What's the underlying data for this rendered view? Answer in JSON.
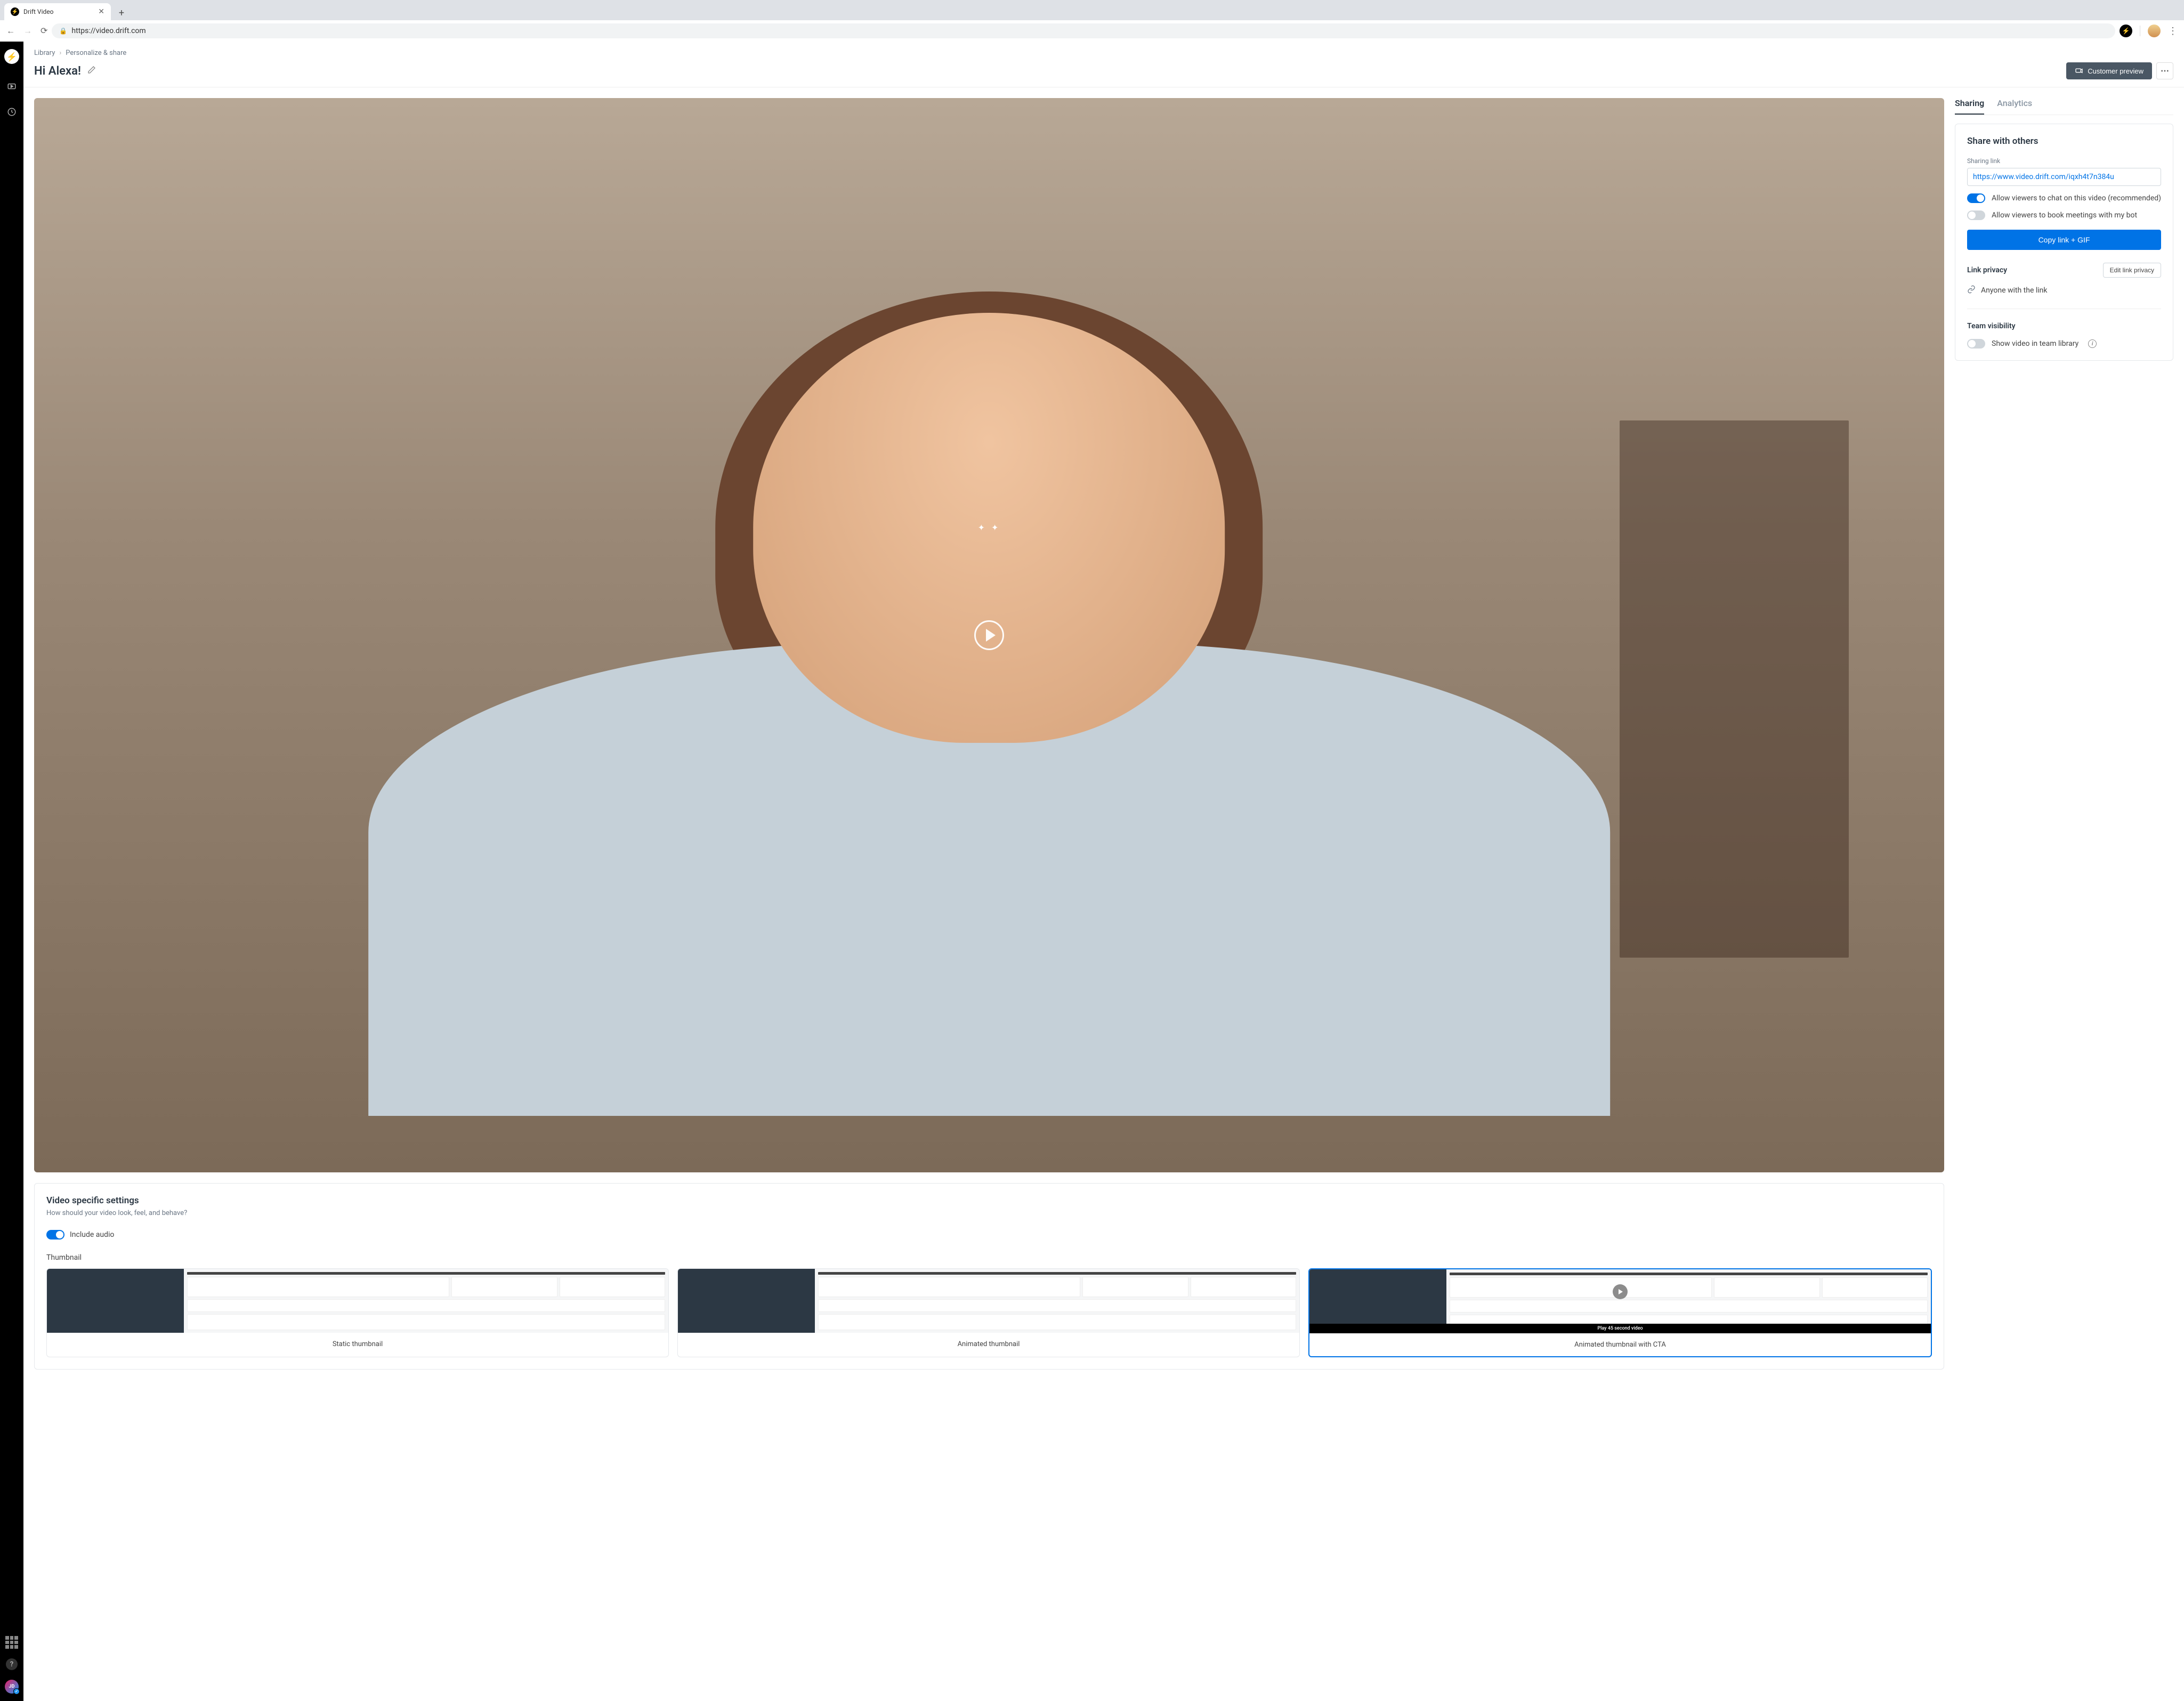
{
  "browser": {
    "tab_title": "Drift Video",
    "url": "https://video.drift.com"
  },
  "sidebar": {
    "user_initials": "JD"
  },
  "breadcrumbs": {
    "item1": "Library",
    "item2": "Personalize & share"
  },
  "header": {
    "title": "Hi Alexa!",
    "preview_button": "Customer preview"
  },
  "settings": {
    "heading": "Video specific settings",
    "subtitle": "How should your video look, feel, and behave?",
    "audio_label": "Include audio",
    "audio_on": true,
    "thumbnail_label": "Thumbnail",
    "thumbnails": {
      "option1": "Static thumbnail",
      "option2": "Animated thumbnail",
      "option3": "Animated thumbnail with CTA",
      "cta_overlay": "Play 45 second video"
    }
  },
  "right": {
    "tabs": {
      "sharing": "Sharing",
      "analytics": "Analytics"
    },
    "share_heading": "Share with others",
    "sharing_link_label": "Sharing link",
    "sharing_link": "https://www.video.drift.com/iqxh4t7n384u",
    "chat_label": "Allow viewers to chat on this video (recommended)",
    "chat_on": true,
    "book_label": "Allow viewers to book meetings with my bot",
    "book_on": false,
    "copy_button": "Copy link + GIF",
    "privacy_heading": "Link privacy",
    "privacy_edit": "Edit link privacy",
    "privacy_value": "Anyone with the link",
    "team_heading": "Team visibility",
    "team_label": "Show video in team library",
    "team_on": false
  }
}
